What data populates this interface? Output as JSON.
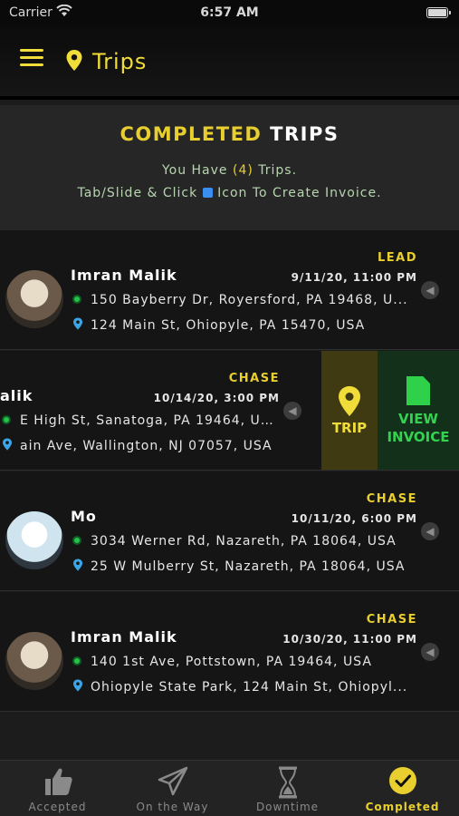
{
  "status_bar": {
    "carrier": "Carrier",
    "time": "6:57 AM"
  },
  "nav": {
    "title": "Trips"
  },
  "header": {
    "heading_highlight": "COMPLETED",
    "heading_rest": " TRIPS",
    "line1_pre": "You Have ",
    "line1_count": "(4)",
    "line1_post": " Trips.",
    "line2_pre": "Tab/Slide & Click ",
    "line2_post": " Icon To Create Invoice."
  },
  "trips": [
    {
      "name": "Imran Malik",
      "tag": "LEAD",
      "date": "9/11/20, 11:00 PM",
      "pickup": "150 Bayberry Dr, Royersford, PA 19468, U...",
      "dropoff": "124 Main St, Ohiopyle, PA 15470, USA"
    },
    {
      "name": "alik",
      "tag": "CHASE",
      "date": "10/14/20, 3:00 PM",
      "pickup": "E High St, Sanatoga, PA 19464, USA",
      "dropoff": "ain Ave, Wallington, NJ 07057, USA"
    },
    {
      "name": "Mo",
      "tag": "CHASE",
      "date": "10/11/20, 6:00 PM",
      "pickup": "3034 Werner Rd, Nazareth, PA 18064, USA",
      "dropoff": "25 W Mulberry St, Nazareth, PA 18064, USA"
    },
    {
      "name": "Imran Malik",
      "tag": "CHASE",
      "date": "10/30/20, 11:00 PM",
      "pickup": "140 1st Ave, Pottstown, PA 19464, USA",
      "dropoff": "Ohiopyle State Park, 124 Main St, Ohiopyl..."
    }
  ],
  "swipe_actions": {
    "trip_label": "TRIP",
    "invoice_label_1": "VIEW",
    "invoice_label_2": "INVOICE"
  },
  "tabs": [
    {
      "label": "Accepted",
      "icon": "thumbs-up-icon"
    },
    {
      "label": "On the Way",
      "icon": "paper-plane-icon"
    },
    {
      "label": "Downtime",
      "icon": "hourglass-icon"
    },
    {
      "label": "Completed",
      "icon": "check-circle-icon"
    }
  ],
  "colors": {
    "accent": "#e8cf2f",
    "invoice": "#35d150",
    "background": "#1c1c1c"
  }
}
